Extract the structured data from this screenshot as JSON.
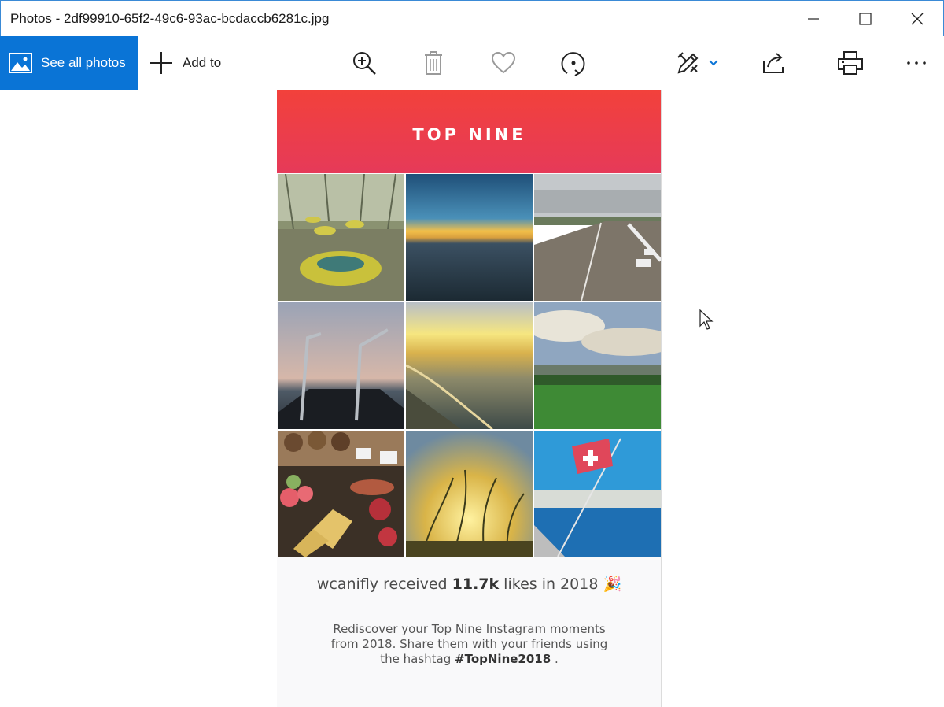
{
  "window": {
    "title": "Photos - 2df99910-65f2-49c6-93ac-bcdaccb6281c.jpg"
  },
  "toolbar": {
    "see_all_label": "See all photos",
    "add_to_label": "Add to",
    "icons": [
      "zoom-in-icon",
      "delete-icon",
      "favorite-icon",
      "rotate-icon",
      "edit-create-icon",
      "share-icon",
      "print-icon",
      "more-icon"
    ]
  },
  "image": {
    "banner_title": "TOP NINE",
    "likes_prefix": "wcanifly received ",
    "likes_count": "11.7k",
    "likes_suffix": " likes in 2018 🎉",
    "promo_text_1": "Rediscover your Top Nine Instagram moments from 2018. Share them with your friends using the hashtag ",
    "promo_hashtag": "#TopNine2018",
    "promo_text_2": " .",
    "photos": [
      "bumper-cars-photo",
      "sunset-sea-photo",
      "runway-photo",
      "boat-deck-photo",
      "beach-sunset-photo",
      "green-field-photo",
      "pastry-display-photo",
      "grass-sunset-photo",
      "swiss-flag-lake-photo"
    ]
  },
  "colors": {
    "accent": "#0a74d6",
    "banner_top": "#f2413b",
    "banner_bottom": "#e63a59"
  }
}
